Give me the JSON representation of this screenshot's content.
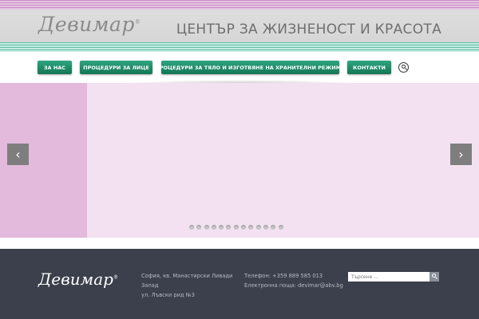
{
  "header": {
    "logo_text": "Девимар",
    "logo_mark": "®",
    "tagline": "ЦЕНТЪР ЗА ЖИЗНЕНОСТ И КРАСОТА"
  },
  "nav": {
    "items": [
      {
        "label": "ЗА НАС"
      },
      {
        "label": "ПРОЦЕДУРИ ЗА ЛИЦЕ"
      },
      {
        "label": "ПРОЦЕДУРИ ЗА ТЯЛО И ИЗГОТВЯНЕ НА ХРАНИТЕЛНИ РЕЖИМИ"
      },
      {
        "label": "КОНТАКТИ"
      }
    ],
    "search_icon": "search-icon"
  },
  "slider": {
    "prev_glyph": "‹",
    "next_glyph": "›",
    "dot_count": 13,
    "colors": {
      "left_panel": "#e3b9dc",
      "background": "#f3e1f1"
    }
  },
  "footer": {
    "logo_text": "Девимар",
    "logo_mark": "®",
    "address": {
      "line1": "София, кв. Манастирски Ливади",
      "line2": "Запад",
      "line3": "ул. Лъвски рид №3"
    },
    "contact": {
      "phone": "Телефон: +359 889 585 013",
      "email": "Електронна поща: devimar@abv.bg"
    },
    "search": {
      "placeholder": "Търсене ..."
    }
  },
  "colors": {
    "nav_button": "#1e8a66",
    "footer_bg": "#3b404c"
  }
}
